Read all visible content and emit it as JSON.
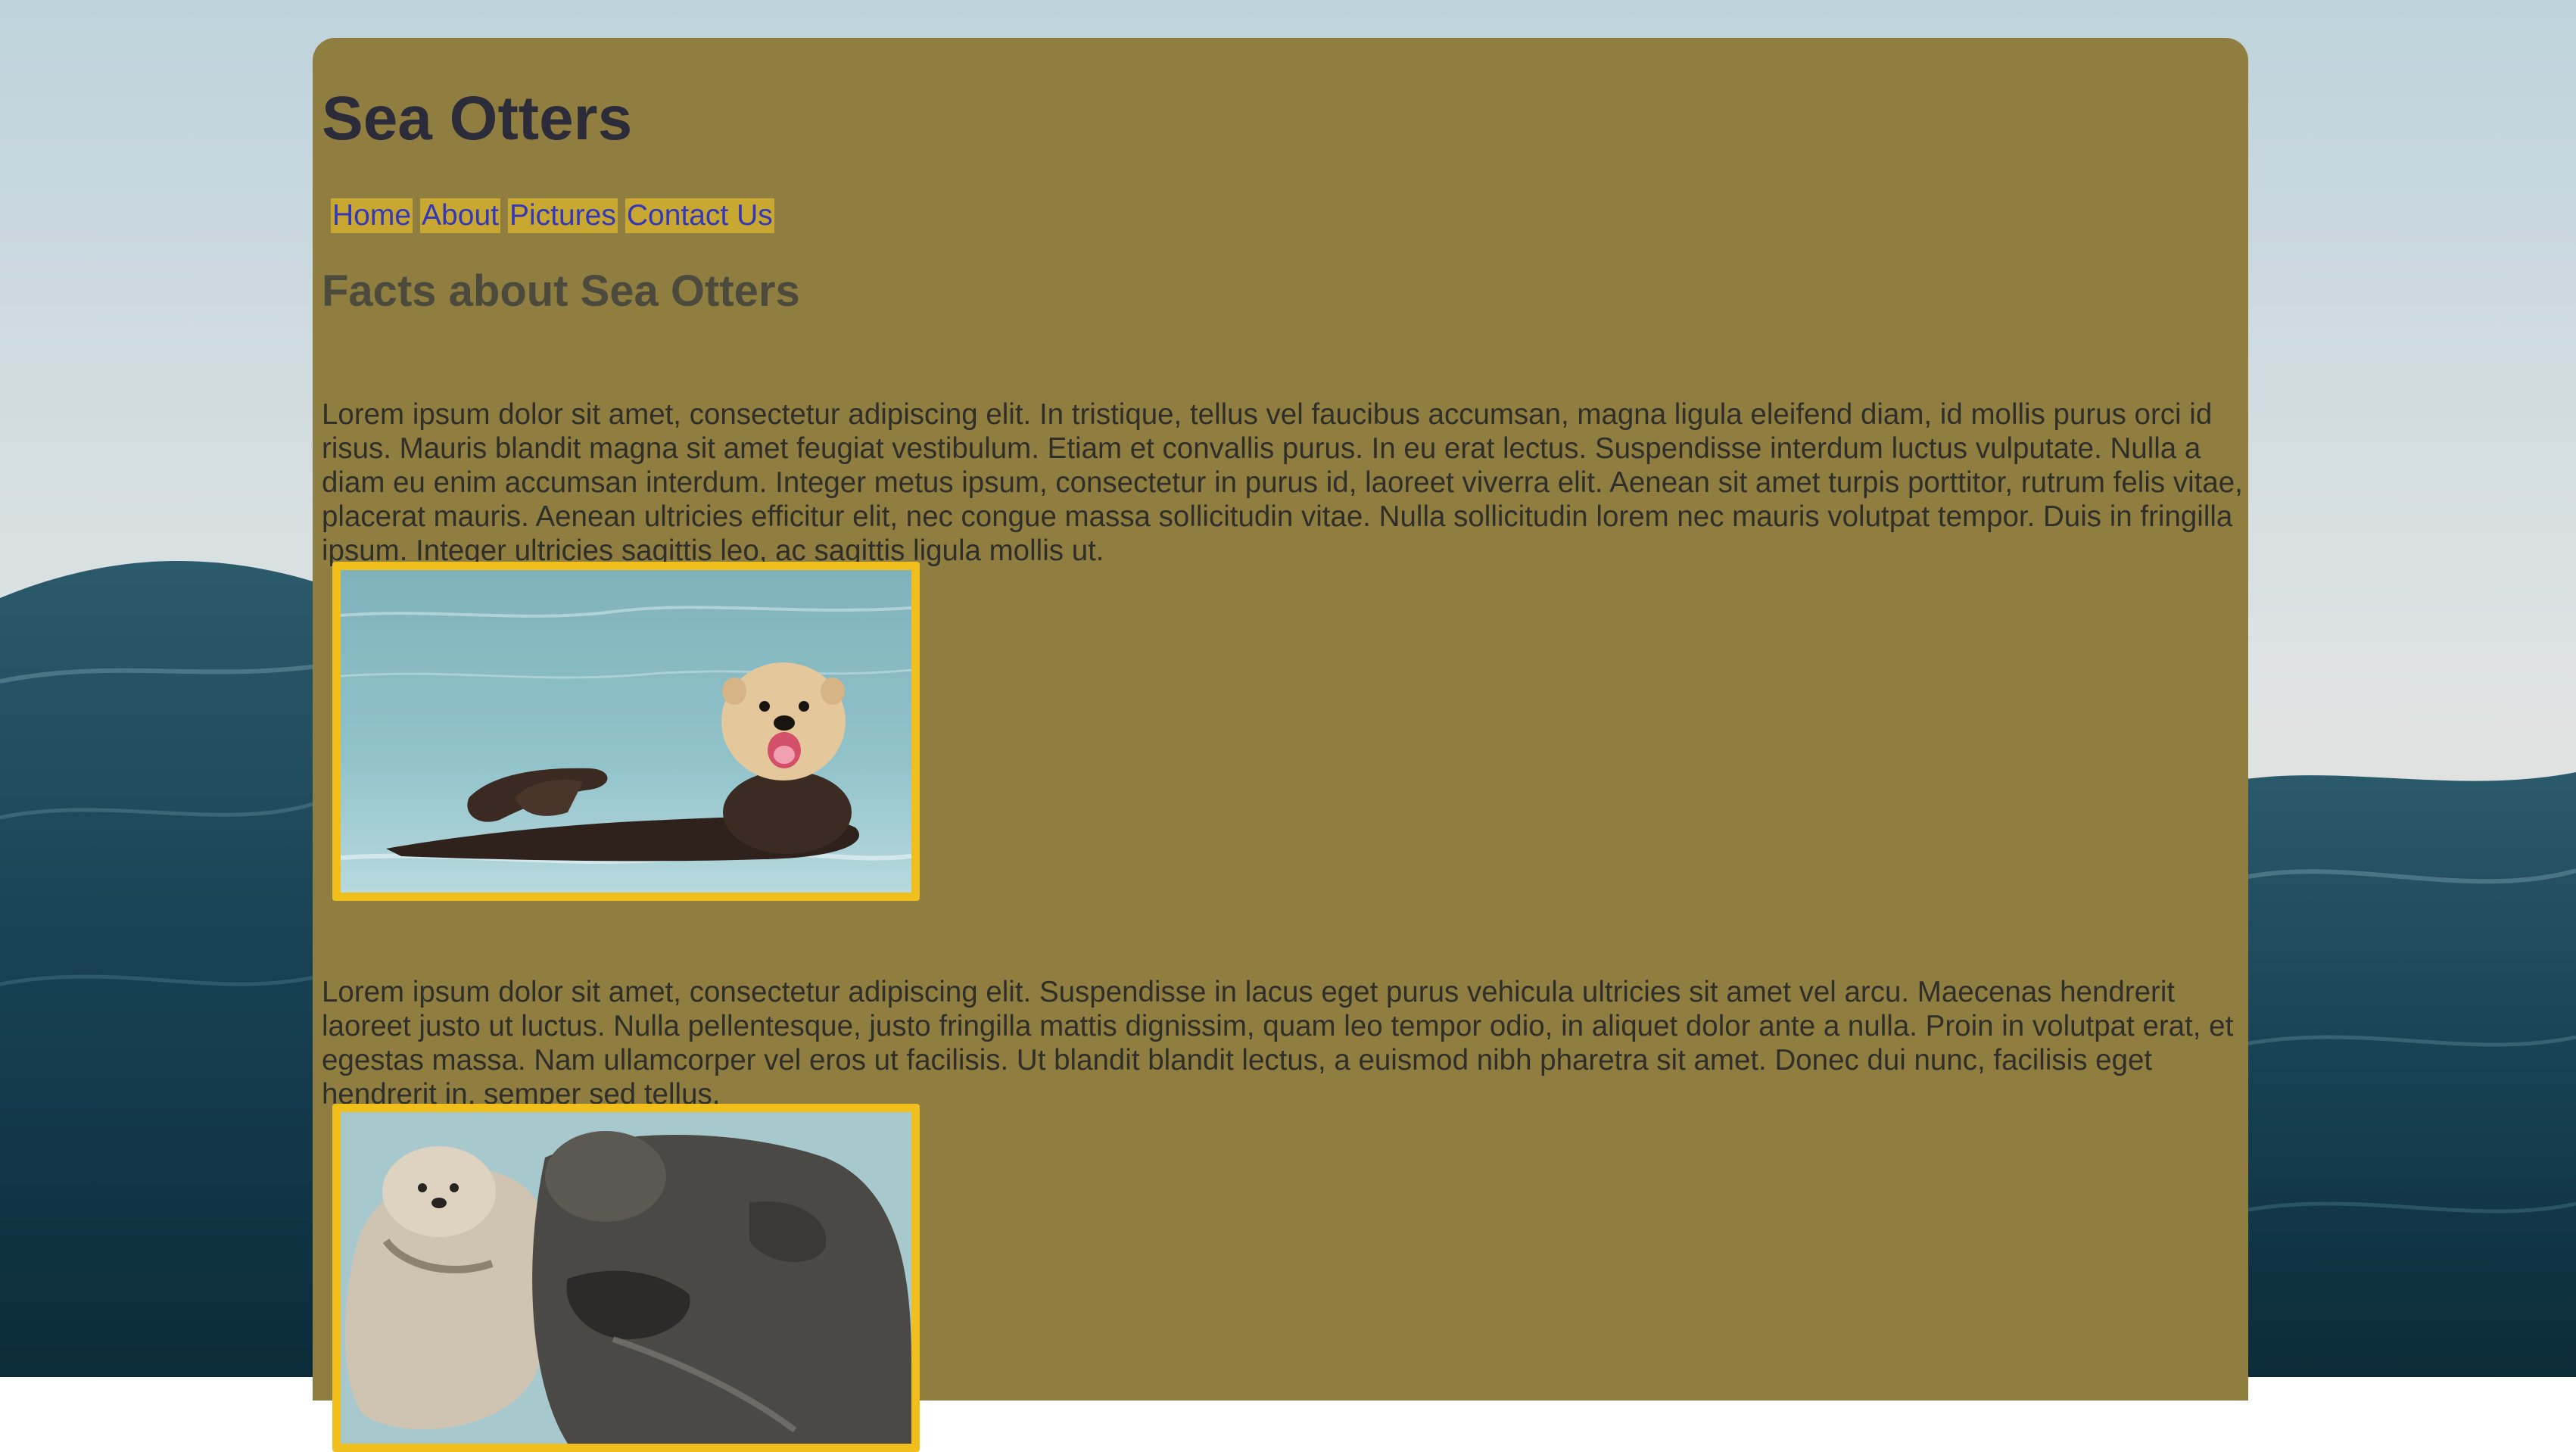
{
  "site": {
    "title": "Sea Otters"
  },
  "nav": {
    "items": [
      {
        "label": "Home"
      },
      {
        "label": "About"
      },
      {
        "label": "Pictures"
      },
      {
        "label": "Contact Us"
      }
    ]
  },
  "main": {
    "heading": "Facts about Sea Otters",
    "paragraph_1": "Lorem ipsum dolor sit amet, consectetur adipiscing elit. In tristique, tellus vel faucibus accumsan, magna ligula eleifend diam, id mollis purus orci id risus. Mauris blandit magna sit amet feugiat vestibulum. Etiam et convallis purus. In eu erat lectus. Suspendisse interdum luctus vulputate. Nulla a diam eu enim accumsan interdum. Integer metus ipsum, consectetur in purus id, laoreet viverra elit. Aenean sit amet turpis porttitor, rutrum felis vitae, placerat mauris. Aenean ultricies efficitur elit, nec congue massa sollicitudin vitae. Nulla sollicitudin lorem nec mauris volutpat tempor. Duis in fringilla ipsum. Integer ultricies sagittis leo, ac sagittis ligula mollis ut.",
    "paragraph_2": "Lorem ipsum dolor sit amet, consectetur adipiscing elit. Suspendisse in lacus eget purus vehicula ultricies sit amet vel arcu. Maecenas hendrerit laoreet justo ut luctus. Nulla pellentesque, justo fringilla mattis dignissim, quam leo tempor odio, in aliquet dolor ante a nulla. Proin in volutpat erat, et egestas massa. Nam ullamcorper vel eros ut facilisis. Ut blandit blandit lectus, a euismod nibh pharetra sit amet. Donec dui nunc, facilisis eget hendrerit in, semper sed tellus."
  },
  "colors": {
    "panel_background": "#8f7e40",
    "nav_item_background": "#c8a831",
    "nav_link_text": "#3438b8",
    "image_border": "#f1bf1b",
    "title_text": "#2b2b3a",
    "body_text": "#2f2e28"
  },
  "images": [
    {
      "subject": "sea otter floating on its back with mouth open"
    },
    {
      "subject": "two sea otters floating together holding paws"
    }
  ]
}
